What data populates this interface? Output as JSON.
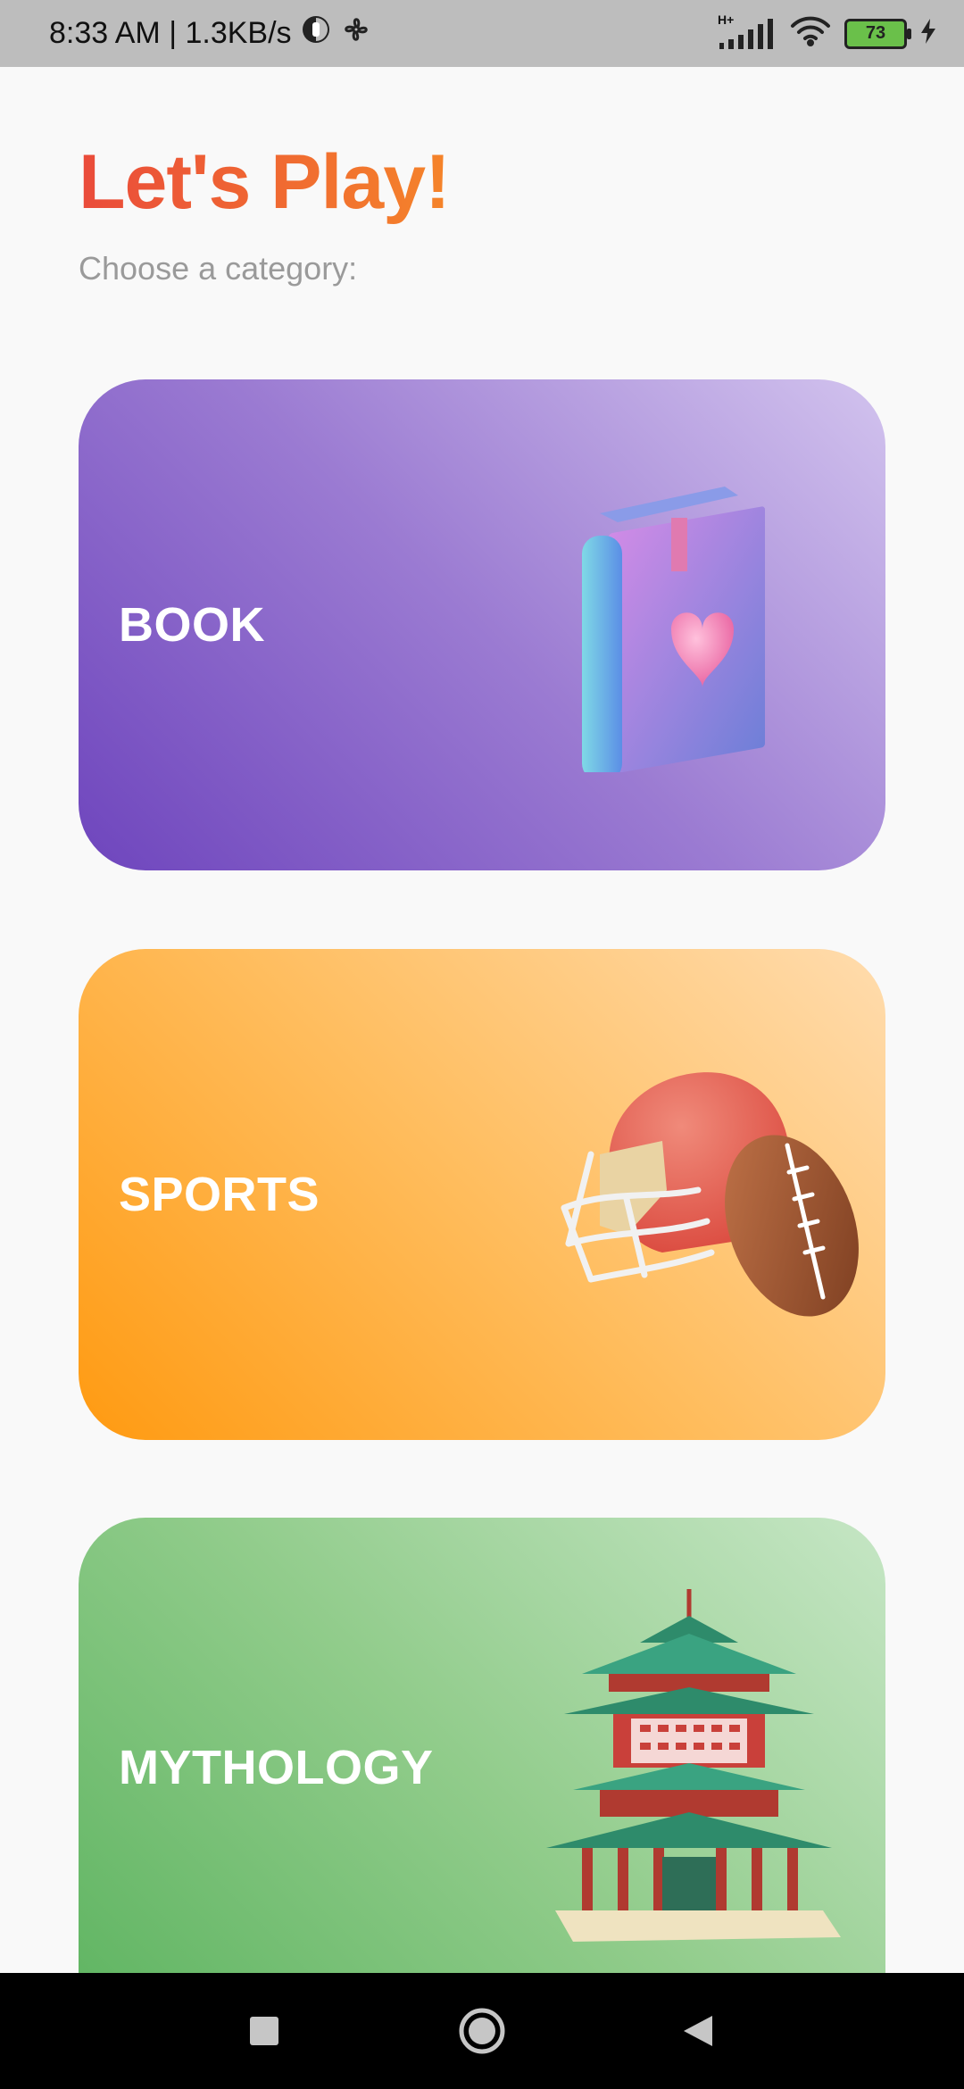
{
  "status_bar": {
    "time_speed": "8:33 AM | 1.3KB/s",
    "network_type": "H+",
    "battery_level": "73",
    "icons": [
      "data-saver-icon",
      "fan-icon",
      "signal-icon",
      "wifi-icon",
      "battery-icon",
      "charging-icon"
    ]
  },
  "header": {
    "title": "Let's Play!",
    "subtitle": "Choose a category:"
  },
  "categories": [
    {
      "label": "BOOK",
      "icon": "book-heart-icon",
      "colors": [
        "#6e45bd",
        "#d2c3ee"
      ]
    },
    {
      "label": "SPORTS",
      "icon": "football-helmet-icon",
      "colors": [
        "#ff9a11",
        "#ffdcae"
      ]
    },
    {
      "label": "MYTHOLOGY",
      "icon": "pagoda-icon",
      "colors": [
        "#5cb35f",
        "#c6e6c5"
      ]
    }
  ],
  "nav_bar": {
    "buttons": [
      "recents-button",
      "home-button",
      "back-button"
    ]
  }
}
